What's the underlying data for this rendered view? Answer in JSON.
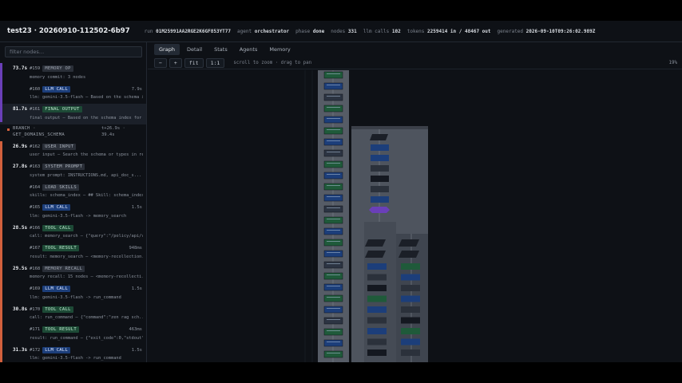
{
  "header": {
    "title": "test23 · 20260910-112502-6b97",
    "meta": [
      {
        "key": "run",
        "value": "01M25991AA2RGE2K6GF853YT77"
      },
      {
        "key": "agent",
        "value": "orchestrator"
      },
      {
        "key": "phase",
        "value": "done"
      },
      {
        "key": "nodes",
        "value": "331"
      },
      {
        "key": "llm calls",
        "value": "102"
      },
      {
        "key": "tokens",
        "value": "2259414 in / 48467 out"
      },
      {
        "key": "generated",
        "value": "2026-09-10T09:26:02.989Z"
      }
    ]
  },
  "sidebar": {
    "filter_placeholder": "filter nodes…",
    "entries": [
      {
        "ts": "73.7s",
        "id": "#159",
        "badge": "MEMORY OP",
        "kind": "memory",
        "detail": "memory commit: 3 nodes",
        "dur": ""
      },
      {
        "ts": "",
        "id": "#160",
        "badge": "LLM CALL",
        "kind": "llm",
        "detail": "llm: gemini-3.5-flash — Based on the schema in...",
        "dur": "7.9s"
      },
      {
        "ts": "81.7s",
        "id": "#161",
        "badge": "FINAL OUTPUT",
        "kind": "final",
        "detail": "final output — Based on the schema index for \"...",
        "dur": "",
        "selected": true
      },
      {
        "branch": true,
        "line1": "BRANCH ·",
        "line2": "GET_DOMAINS_SCHEMA",
        "right1": "t+26.9s ·",
        "right2": "39.4s"
      },
      {
        "ts": "26.9s",
        "id": "#162",
        "badge": "USER INPUT",
        "kind": "input",
        "detail": "user input — Search the schema or types in res...",
        "dur": ""
      },
      {
        "ts": "27.8s",
        "id": "#163",
        "badge": "SYSTEM PROMPT",
        "kind": "system",
        "detail": "system prompt: INSTRUCTIONS.md, api_doc_s...",
        "dur": ""
      },
      {
        "ts": "",
        "id": "#164",
        "badge": "LOAD SKILLS",
        "kind": "skill",
        "detail": "skills: schema_index — ## Skill: schema_index ...",
        "dur": ""
      },
      {
        "ts": "",
        "id": "#165",
        "badge": "LLM CALL",
        "kind": "llm",
        "detail": "llm: gemini-3.5-flash -> memory_search",
        "dur": "1.5s"
      },
      {
        "ts": "28.5s",
        "id": "#166",
        "badge": "TOOL CALL",
        "kind": "tool",
        "detail": "call: memory_search — {\"query\":\"/policy/api/v1/i...",
        "dur": ""
      },
      {
        "ts": "",
        "id": "#167",
        "badge": "TOOL RESULT",
        "kind": "tool",
        "detail": "result: memory_search — <memory-recollection...",
        "dur": "948ms"
      },
      {
        "ts": "29.5s",
        "id": "#168",
        "badge": "MEMORY RECALL",
        "kind": "memory",
        "detail": "memory recall: 15 nodes — <memory-recollecti...",
        "dur": ""
      },
      {
        "ts": "",
        "id": "#169",
        "badge": "LLM CALL",
        "kind": "llm",
        "detail": "llm: gemini-3.5-flash -> run_command",
        "dur": "1.5s"
      },
      {
        "ts": "30.8s",
        "id": "#170",
        "badge": "TOOL CALL",
        "kind": "tool",
        "detail": "call: run_command — {\"command\":\"zen rag sch...",
        "dur": ""
      },
      {
        "ts": "",
        "id": "#171",
        "badge": "TOOL RESULT",
        "kind": "tool",
        "detail": "result: run_command — {\"exit_code\":0,\"stdout\"...",
        "dur": "463ms"
      },
      {
        "ts": "31.3s",
        "id": "#172",
        "badge": "LLM CALL",
        "kind": "llm",
        "detail": "llm: gemini-3.5-flash -> run_command",
        "dur": "1.5s"
      }
    ]
  },
  "tabs": [
    "Graph",
    "Detail",
    "Stats",
    "Agents",
    "Memory"
  ],
  "active_tab": "Graph",
  "toolbar": {
    "zoom_out": "−",
    "zoom_in": "+",
    "fit": "fit",
    "reset": "1:1",
    "hint": "scroll to zoom · drag to pan",
    "zoom_level": "19%"
  },
  "colors": {
    "background": "#0e1116",
    "llm": "#1c3e7a",
    "tool": "#1d4a36",
    "branch_rail": "#d2603d",
    "memory_node": "#6a3fb8"
  }
}
